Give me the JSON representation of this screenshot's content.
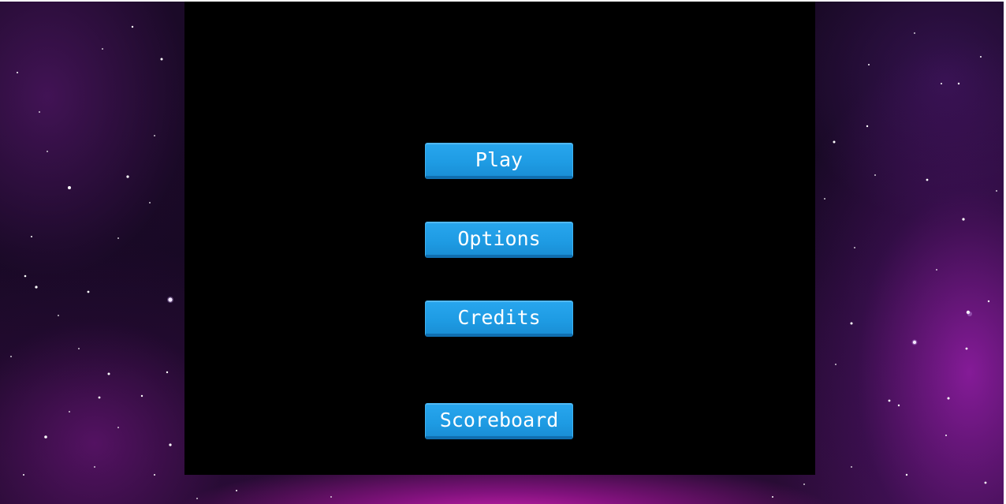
{
  "menu": {
    "play_label": "Play",
    "options_label": "Options",
    "credits_label": "Credits",
    "scoreboard_label": "Scoreboard"
  },
  "colors": {
    "button_fill": "#1e9be3",
    "button_shadow": "#106fb0",
    "panel": "#000000",
    "nebula": "#c21fa8"
  }
}
